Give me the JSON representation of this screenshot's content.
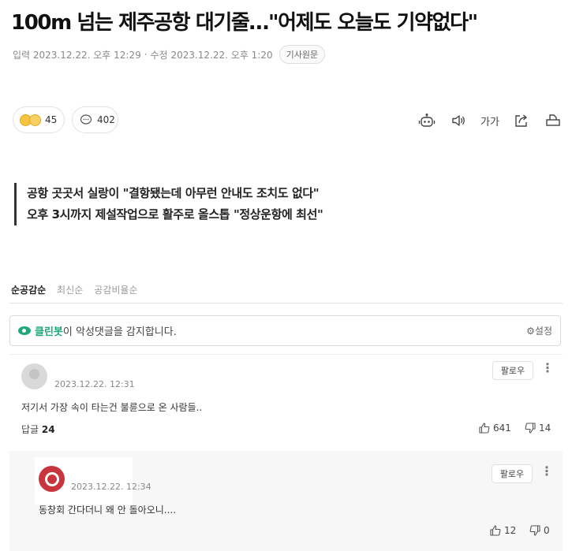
{
  "article": {
    "headline": "100m 넘는 제주공항 대기줄…\"어제도 오늘도 기약없다\"",
    "published": "입력 2023.12.22. 오후 12:29",
    "modified": "수정 2023.12.22. 오후 1:20",
    "original_button": "기사원문"
  },
  "reactions": {
    "reaction_count": "45",
    "comment_count": "402"
  },
  "tools": {
    "bot_icon": "robot-icon",
    "speaker_icon": "speaker-icon",
    "font_size_label": "가가",
    "share_icon": "share-icon",
    "print_icon": "print-icon"
  },
  "summary": [
    "공항 곳곳서 실랑이 \"결항됐는데 아무런 안내도 조치도 없다\"",
    "오후 3시까지 제설작업으로 활주로 올스톱 \"정상운항에 최선\""
  ],
  "sort_tabs": [
    "순공감순",
    "최신순",
    "공감비율순"
  ],
  "cleanbot": {
    "brand": "클린봇",
    "message": "이 악성댓글을 감지합니다.",
    "settings_label": "설정",
    "brand_color": "#1ea97c"
  },
  "comments": [
    {
      "date": "2023.12.22. 12:31",
      "follow_label": "팔로우",
      "text": "저기서 가장 속이 타는건 불륜으로 온 사람들..",
      "reply_label": "답글",
      "reply_count": "24",
      "likes": "641",
      "dislikes": "14"
    },
    {
      "date": "2023.12.22. 12:34",
      "follow_label": "팔로우",
      "text": "동창회 간다더니 왜 안 돌아오니....",
      "likes": "12",
      "dislikes": "0"
    }
  ]
}
